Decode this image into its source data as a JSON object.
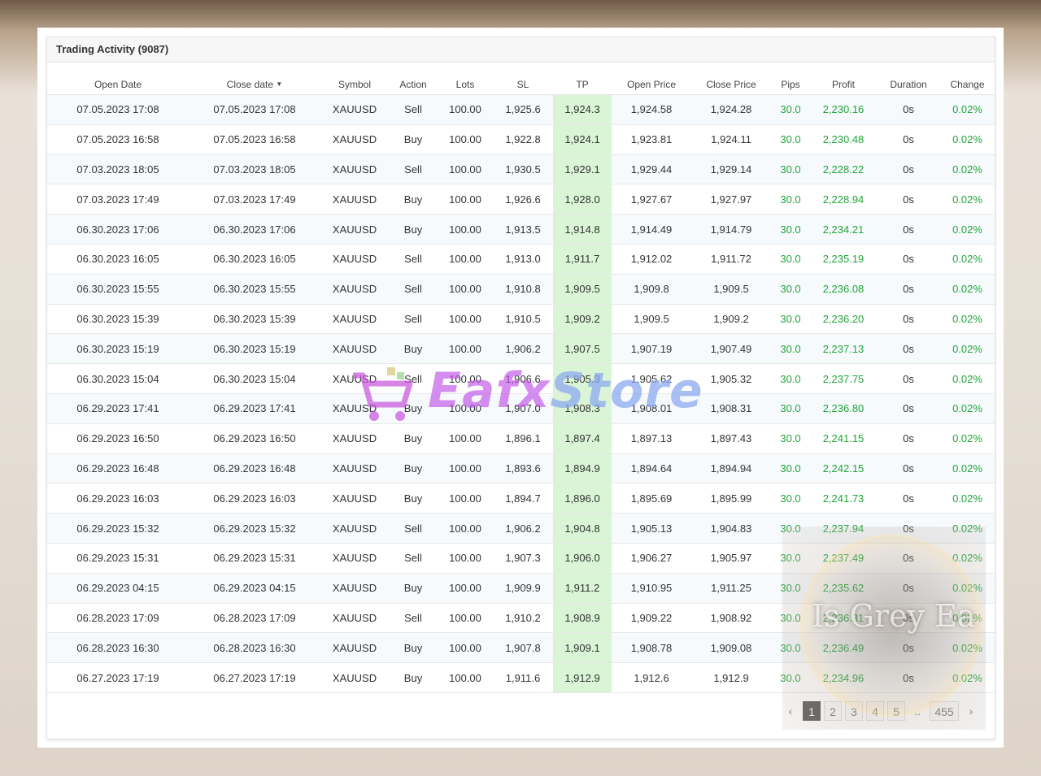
{
  "panel": {
    "title": "Trading Activity (9087)"
  },
  "columns": {
    "open_date": "Open Date",
    "close_date": "Close date",
    "symbol": "Symbol",
    "action": "Action",
    "lots": "Lots",
    "sl": "SL",
    "tp": "TP",
    "open_price": "Open Price",
    "close_price": "Close Price",
    "pips": "Pips",
    "profit": "Profit",
    "duration": "Duration",
    "change": "Change"
  },
  "rows": [
    {
      "open_date": "07.05.2023 17:08",
      "close_date": "07.05.2023 17:08",
      "symbol": "XAUUSD",
      "action": "Sell",
      "lots": "100.00",
      "sl": "1,925.6",
      "tp": "1,924.3",
      "open_price": "1,924.58",
      "close_price": "1,924.28",
      "pips": "30.0",
      "profit": "2,230.16",
      "duration": "0s",
      "change": "0.02%"
    },
    {
      "open_date": "07.05.2023 16:58",
      "close_date": "07.05.2023 16:58",
      "symbol": "XAUUSD",
      "action": "Buy",
      "lots": "100.00",
      "sl": "1,922.8",
      "tp": "1,924.1",
      "open_price": "1,923.81",
      "close_price": "1,924.11",
      "pips": "30.0",
      "profit": "2,230.48",
      "duration": "0s",
      "change": "0.02%"
    },
    {
      "open_date": "07.03.2023 18:05",
      "close_date": "07.03.2023 18:05",
      "symbol": "XAUUSD",
      "action": "Sell",
      "lots": "100.00",
      "sl": "1,930.5",
      "tp": "1,929.1",
      "open_price": "1,929.44",
      "close_price": "1,929.14",
      "pips": "30.0",
      "profit": "2,228.22",
      "duration": "0s",
      "change": "0.02%"
    },
    {
      "open_date": "07.03.2023 17:49",
      "close_date": "07.03.2023 17:49",
      "symbol": "XAUUSD",
      "action": "Buy",
      "lots": "100.00",
      "sl": "1,926.6",
      "tp": "1,928.0",
      "open_price": "1,927.67",
      "close_price": "1,927.97",
      "pips": "30.0",
      "profit": "2,228.94",
      "duration": "0s",
      "change": "0.02%"
    },
    {
      "open_date": "06.30.2023 17:06",
      "close_date": "06.30.2023 17:06",
      "symbol": "XAUUSD",
      "action": "Buy",
      "lots": "100.00",
      "sl": "1,913.5",
      "tp": "1,914.8",
      "open_price": "1,914.49",
      "close_price": "1,914.79",
      "pips": "30.0",
      "profit": "2,234.21",
      "duration": "0s",
      "change": "0.02%"
    },
    {
      "open_date": "06.30.2023 16:05",
      "close_date": "06.30.2023 16:05",
      "symbol": "XAUUSD",
      "action": "Sell",
      "lots": "100.00",
      "sl": "1,913.0",
      "tp": "1,911.7",
      "open_price": "1,912.02",
      "close_price": "1,911.72",
      "pips": "30.0",
      "profit": "2,235.19",
      "duration": "0s",
      "change": "0.02%"
    },
    {
      "open_date": "06.30.2023 15:55",
      "close_date": "06.30.2023 15:55",
      "symbol": "XAUUSD",
      "action": "Sell",
      "lots": "100.00",
      "sl": "1,910.8",
      "tp": "1,909.5",
      "open_price": "1,909.8",
      "close_price": "1,909.5",
      "pips": "30.0",
      "profit": "2,236.08",
      "duration": "0s",
      "change": "0.02%"
    },
    {
      "open_date": "06.30.2023 15:39",
      "close_date": "06.30.2023 15:39",
      "symbol": "XAUUSD",
      "action": "Sell",
      "lots": "100.00",
      "sl": "1,910.5",
      "tp": "1,909.2",
      "open_price": "1,909.5",
      "close_price": "1,909.2",
      "pips": "30.0",
      "profit": "2,236.20",
      "duration": "0s",
      "change": "0.02%"
    },
    {
      "open_date": "06.30.2023 15:19",
      "close_date": "06.30.2023 15:19",
      "symbol": "XAUUSD",
      "action": "Buy",
      "lots": "100.00",
      "sl": "1,906.2",
      "tp": "1,907.5",
      "open_price": "1,907.19",
      "close_price": "1,907.49",
      "pips": "30.0",
      "profit": "2,237.13",
      "duration": "0s",
      "change": "0.02%"
    },
    {
      "open_date": "06.30.2023 15:04",
      "close_date": "06.30.2023 15:04",
      "symbol": "XAUUSD",
      "action": "Sell",
      "lots": "100.00",
      "sl": "1,906.6",
      "tp": "1,905.3",
      "open_price": "1,905.62",
      "close_price": "1,905.32",
      "pips": "30.0",
      "profit": "2,237.75",
      "duration": "0s",
      "change": "0.02%"
    },
    {
      "open_date": "06.29.2023 17:41",
      "close_date": "06.29.2023 17:41",
      "symbol": "XAUUSD",
      "action": "Buy",
      "lots": "100.00",
      "sl": "1,907.0",
      "tp": "1,908.3",
      "open_price": "1,908.01",
      "close_price": "1,908.31",
      "pips": "30.0",
      "profit": "2,236.80",
      "duration": "0s",
      "change": "0.02%"
    },
    {
      "open_date": "06.29.2023 16:50",
      "close_date": "06.29.2023 16:50",
      "symbol": "XAUUSD",
      "action": "Buy",
      "lots": "100.00",
      "sl": "1,896.1",
      "tp": "1,897.4",
      "open_price": "1,897.13",
      "close_price": "1,897.43",
      "pips": "30.0",
      "profit": "2,241.15",
      "duration": "0s",
      "change": "0.02%"
    },
    {
      "open_date": "06.29.2023 16:48",
      "close_date": "06.29.2023 16:48",
      "symbol": "XAUUSD",
      "action": "Buy",
      "lots": "100.00",
      "sl": "1,893.6",
      "tp": "1,894.9",
      "open_price": "1,894.64",
      "close_price": "1,894.94",
      "pips": "30.0",
      "profit": "2,242.15",
      "duration": "0s",
      "change": "0.02%"
    },
    {
      "open_date": "06.29.2023 16:03",
      "close_date": "06.29.2023 16:03",
      "symbol": "XAUUSD",
      "action": "Buy",
      "lots": "100.00",
      "sl": "1,894.7",
      "tp": "1,896.0",
      "open_price": "1,895.69",
      "close_price": "1,895.99",
      "pips": "30.0",
      "profit": "2,241.73",
      "duration": "0s",
      "change": "0.02%"
    },
    {
      "open_date": "06.29.2023 15:32",
      "close_date": "06.29.2023 15:32",
      "symbol": "XAUUSD",
      "action": "Sell",
      "lots": "100.00",
      "sl": "1,906.2",
      "tp": "1,904.8",
      "open_price": "1,905.13",
      "close_price": "1,904.83",
      "pips": "30.0",
      "profit": "2,237.94",
      "duration": "0s",
      "change": "0.02%"
    },
    {
      "open_date": "06.29.2023 15:31",
      "close_date": "06.29.2023 15:31",
      "symbol": "XAUUSD",
      "action": "Sell",
      "lots": "100.00",
      "sl": "1,907.3",
      "tp": "1,906.0",
      "open_price": "1,906.27",
      "close_price": "1,905.97",
      "pips": "30.0",
      "profit": "2,237.49",
      "duration": "0s",
      "change": "0.02%"
    },
    {
      "open_date": "06.29.2023 04:15",
      "close_date": "06.29.2023 04:15",
      "symbol": "XAUUSD",
      "action": "Buy",
      "lots": "100.00",
      "sl": "1,909.9",
      "tp": "1,911.2",
      "open_price": "1,910.95",
      "close_price": "1,911.25",
      "pips": "30.0",
      "profit": "2,235.62",
      "duration": "0s",
      "change": "0.02%"
    },
    {
      "open_date": "06.28.2023 17:09",
      "close_date": "06.28.2023 17:09",
      "symbol": "XAUUSD",
      "action": "Sell",
      "lots": "100.00",
      "sl": "1,910.2",
      "tp": "1,908.9",
      "open_price": "1,909.22",
      "close_price": "1,908.92",
      "pips": "30.0",
      "profit": "2,236.31",
      "duration": "0s",
      "change": "0.02%"
    },
    {
      "open_date": "06.28.2023 16:30",
      "close_date": "06.28.2023 16:30",
      "symbol": "XAUUSD",
      "action": "Buy",
      "lots": "100.00",
      "sl": "1,907.8",
      "tp": "1,909.1",
      "open_price": "1,908.78",
      "close_price": "1,909.08",
      "pips": "30.0",
      "profit": "2,236.49",
      "duration": "0s",
      "change": "0.02%"
    },
    {
      "open_date": "06.27.2023 17:19",
      "close_date": "06.27.2023 17:19",
      "symbol": "XAUUSD",
      "action": "Buy",
      "lots": "100.00",
      "sl": "1,911.6",
      "tp": "1,912.9",
      "open_price": "1,912.6",
      "close_price": "1,912.9",
      "pips": "30.0",
      "profit": "2,234.96",
      "duration": "0s",
      "change": "0.02%"
    }
  ],
  "pagination": {
    "prev": "‹",
    "pages": [
      "1",
      "2",
      "3",
      "4",
      "5"
    ],
    "ellipsis": "..",
    "last": "455",
    "next": "›",
    "active": "1"
  },
  "watermarks": {
    "store_a": "Eafx",
    "store_b": "Store",
    "grey": "Is Grey Ea"
  },
  "colors": {
    "positive": "#21a539",
    "tp_highlight": "#d9f5d6",
    "row_stripe": "#f7fafd"
  }
}
